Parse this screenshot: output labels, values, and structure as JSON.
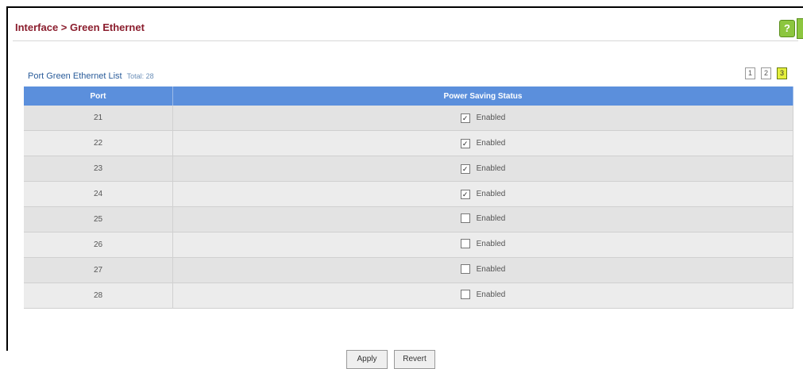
{
  "header": {
    "title": "Interface > Green Ethernet",
    "help_label": "?"
  },
  "list": {
    "title": "Port Green Ethernet List",
    "total": "Total: 28"
  },
  "pager": [
    "1",
    "2",
    "3"
  ],
  "table": {
    "columns": [
      "Port",
      "Power Saving Status"
    ],
    "rows": [
      {
        "port": "21",
        "checked": true,
        "checkmark": "✓",
        "label": "Enabled"
      },
      {
        "port": "22",
        "checked": true,
        "checkmark": "✓",
        "label": "Enabled"
      },
      {
        "port": "23",
        "checked": true,
        "checkmark": "✓",
        "label": "Enabled"
      },
      {
        "port": "24",
        "checked": true,
        "checkmark": "✓",
        "label": "Enabled"
      },
      {
        "port": "25",
        "checked": false,
        "checkmark": "",
        "label": "Enabled"
      },
      {
        "port": "26",
        "checked": false,
        "checkmark": "",
        "label": "Enabled"
      },
      {
        "port": "27",
        "checked": false,
        "checkmark": "",
        "label": "Enabled"
      },
      {
        "port": "28",
        "checked": false,
        "checkmark": "",
        "label": "Enabled"
      }
    ]
  },
  "buttons": {
    "apply": "Apply",
    "revert": "Revert"
  },
  "colors": {
    "title": "#8b1e2e",
    "header_bg": "#5b8fdc",
    "active_page": "#e4ef3c",
    "help": "#8cc63f"
  }
}
